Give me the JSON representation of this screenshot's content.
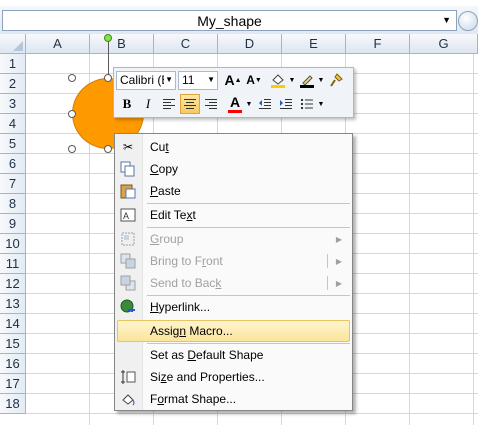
{
  "namebox": {
    "value": "My_shape"
  },
  "columns": [
    "A",
    "B",
    "C",
    "D",
    "E",
    "F",
    "G"
  ],
  "rows": [
    "1",
    "2",
    "3",
    "4",
    "5",
    "6",
    "7",
    "8",
    "9",
    "10",
    "11",
    "12",
    "13",
    "14",
    "15",
    "16",
    "17",
    "18"
  ],
  "shape": {
    "fill_color": "#ff9900"
  },
  "minibar": {
    "font_name": "Calibri (E",
    "font_size": "11",
    "grow_font": "A",
    "shrink_font": "A",
    "bold": "B",
    "italic": "I",
    "font_color_letter": "A",
    "fill_color": "#ffcc00",
    "line_color": "#000000",
    "font_color": "#ff0000"
  },
  "menu": {
    "items": [
      {
        "label_pre": "Cu",
        "label_ul": "t",
        "label_post": "",
        "icon": "scissors-icon",
        "disabled": false
      },
      {
        "label_pre": "",
        "label_ul": "C",
        "label_post": "opy",
        "icon": "copy-icon",
        "disabled": false
      },
      {
        "label_pre": "",
        "label_ul": "P",
        "label_post": "aste",
        "icon": "paste-icon",
        "disabled": false
      },
      {
        "label_pre": "Edit Te",
        "label_ul": "x",
        "label_post": "t",
        "icon": "edit-text-icon",
        "disabled": false
      },
      {
        "label_pre": "",
        "label_ul": "G",
        "label_post": "roup",
        "icon": "group-icon",
        "disabled": true
      },
      {
        "label_pre": "Bring to F",
        "label_ul": "r",
        "label_post": "ont",
        "icon": "bring-to-front-icon",
        "disabled": true
      },
      {
        "label_pre": "Send to Bac",
        "label_ul": "k",
        "label_post": "",
        "icon": "send-to-back-icon",
        "disabled": true
      },
      {
        "label_pre": "",
        "label_ul": "H",
        "label_post": "yperlink...",
        "icon": "hyperlink-icon",
        "disabled": false
      },
      {
        "label_pre": "Assig",
        "label_ul": "n",
        "label_post": " Macro...",
        "icon": "",
        "disabled": false
      },
      {
        "label_pre": "Set as ",
        "label_ul": "D",
        "label_post": "efault Shape",
        "icon": "",
        "disabled": false
      },
      {
        "label_pre": "Si",
        "label_ul": "z",
        "label_post": "e and Properties...",
        "icon": "size-properties-icon",
        "disabled": false
      },
      {
        "label_pre": "F",
        "label_ul": "o",
        "label_post": "rmat Shape...",
        "icon": "format-shape-icon",
        "disabled": false
      }
    ]
  }
}
